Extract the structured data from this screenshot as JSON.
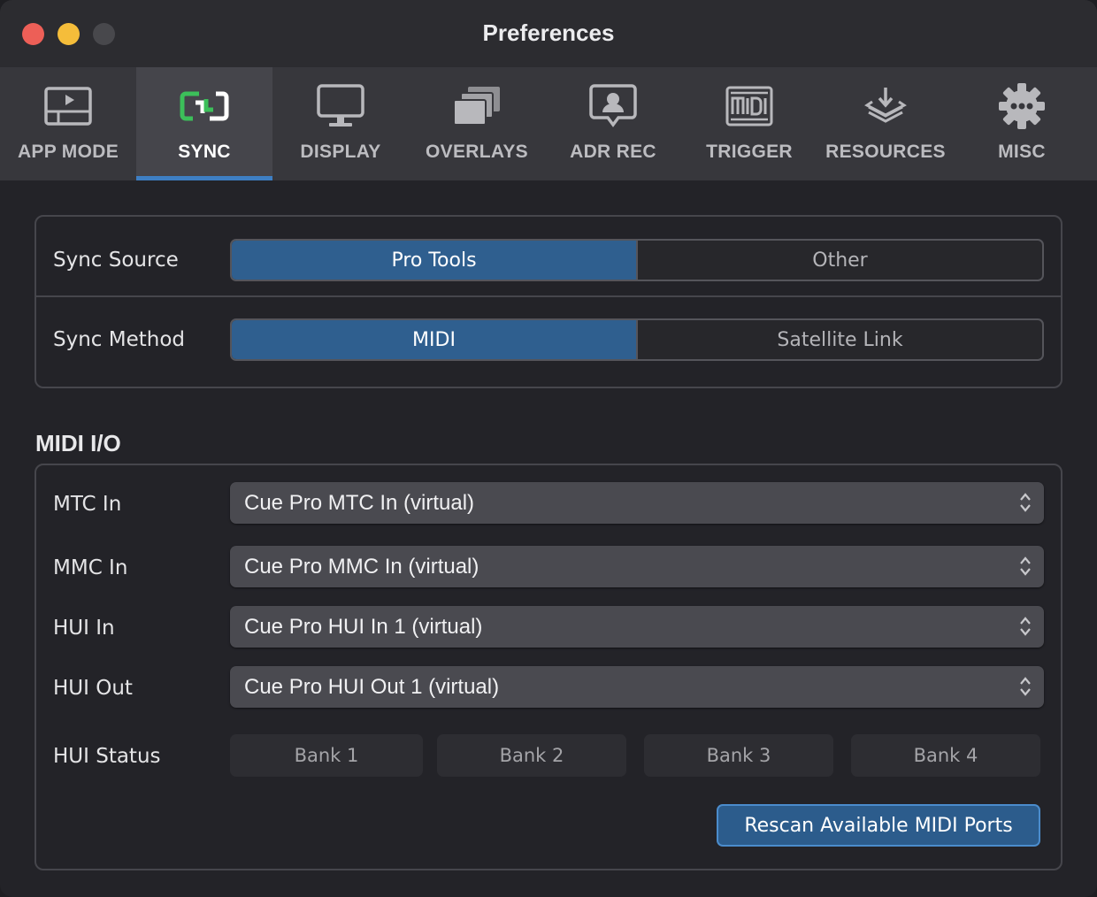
{
  "window": {
    "title": "Preferences"
  },
  "tabs": [
    {
      "label": "APP MODE",
      "icon": "app-mode-icon",
      "active": false
    },
    {
      "label": "SYNC",
      "icon": "sync-icon",
      "active": true
    },
    {
      "label": "DISPLAY",
      "icon": "display-icon",
      "active": false
    },
    {
      "label": "OVERLAYS",
      "icon": "overlays-icon",
      "active": false
    },
    {
      "label": "ADR REC",
      "icon": "adr-rec-icon",
      "active": false
    },
    {
      "label": "TRIGGER",
      "icon": "midi-trigger-icon",
      "active": false
    },
    {
      "label": "RESOURCES",
      "icon": "resources-icon",
      "active": false
    },
    {
      "label": "MISC",
      "icon": "gear-icon",
      "active": false
    }
  ],
  "sync": {
    "source": {
      "label": "Sync Source",
      "options": [
        "Pro Tools",
        "Other"
      ],
      "selected": "Pro Tools"
    },
    "method": {
      "label": "Sync Method",
      "options": [
        "MIDI",
        "Satellite Link"
      ],
      "selected": "MIDI"
    }
  },
  "midi": {
    "title": "MIDI I/O",
    "ports": [
      {
        "label": "MTC In",
        "value": "Cue Pro MTC In (virtual)"
      },
      {
        "label": "MMC In",
        "value": "Cue Pro MMC In (virtual)"
      },
      {
        "label": "HUI In",
        "value": "Cue Pro HUI In 1 (virtual)"
      },
      {
        "label": "HUI Out",
        "value": "Cue Pro HUI Out 1 (virtual)"
      }
    ],
    "hui_status": {
      "label": "HUI Status",
      "banks": [
        "Bank 1",
        "Bank 2",
        "Bank 3",
        "Bank 4"
      ]
    },
    "rescan_label": "Rescan Available MIDI Ports"
  },
  "colors": {
    "accent": "#2f5f8f",
    "sync_icon": "#3cbf5a",
    "close": "#ed5f57",
    "minimize": "#f5bd3a"
  }
}
